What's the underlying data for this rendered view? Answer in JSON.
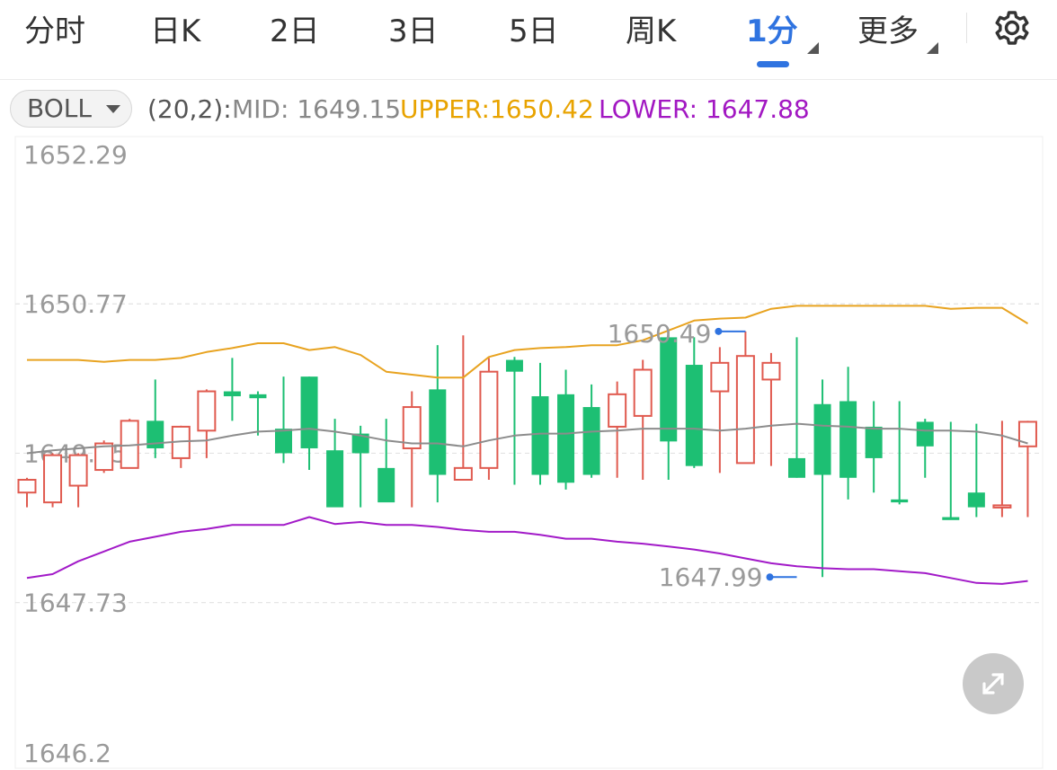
{
  "tabs": {
    "items": [
      {
        "label": "分时"
      },
      {
        "label": "日K"
      },
      {
        "label": "2日"
      },
      {
        "label": "3日"
      },
      {
        "label": "5日"
      },
      {
        "label": "周K"
      },
      {
        "label": "1分"
      },
      {
        "label": "更多"
      }
    ],
    "active_index": 6,
    "active_color": "#2f73e0"
  },
  "indicator": {
    "selector_label": "BOLL",
    "params": "(20,2):",
    "mid_label": "MID: 1649.15",
    "upper_label": "UPPER:1650.42",
    "lower_label": "LOWER: 1647.88",
    "mid_color": "#888888",
    "upper_color": "#e8a300",
    "lower_color": "#a218c2"
  },
  "colors": {
    "up": "#e05a4f",
    "down": "#1dbf73",
    "mid_line": "#8c8c8c",
    "upper_line": "#e8a320",
    "lower_line": "#a21ac8",
    "marker": "#2f73e0"
  },
  "chart_data": {
    "type": "candlestick",
    "interval": "1分",
    "y_ticks": [
      "1652.29",
      "1650.77",
      "1649.25",
      "1647.73",
      "1646.2"
    ],
    "ylim": [
      1646.2,
      1652.29
    ],
    "grid": true,
    "max_marker": {
      "index": 28,
      "label": "1650.49",
      "value": 1650.49
    },
    "min_marker": {
      "index": 30,
      "label": "1647.99",
      "value": 1647.99
    },
    "candles": [
      {
        "o": 1648.85,
        "h": 1649.0,
        "l": 1648.7,
        "c": 1648.98
      },
      {
        "o": 1648.75,
        "h": 1649.25,
        "l": 1648.7,
        "c": 1649.23
      },
      {
        "o": 1648.92,
        "h": 1649.25,
        "l": 1648.7,
        "c": 1649.23
      },
      {
        "o": 1649.08,
        "h": 1649.38,
        "l": 1649.05,
        "c": 1649.35
      },
      {
        "o": 1649.1,
        "h": 1649.6,
        "l": 1649.1,
        "c": 1649.58
      },
      {
        "o": 1649.58,
        "h": 1650.0,
        "l": 1649.2,
        "c": 1649.3
      },
      {
        "o": 1649.2,
        "h": 1649.53,
        "l": 1649.1,
        "c": 1649.52
      },
      {
        "o": 1649.48,
        "h": 1649.9,
        "l": 1649.2,
        "c": 1649.88
      },
      {
        "o": 1649.88,
        "h": 1650.22,
        "l": 1649.58,
        "c": 1649.83
      },
      {
        "o": 1649.85,
        "h": 1649.88,
        "l": 1649.43,
        "c": 1649.81
      },
      {
        "o": 1649.5,
        "h": 1650.03,
        "l": 1649.15,
        "c": 1649.25
      },
      {
        "o": 1650.03,
        "h": 1650.03,
        "l": 1649.08,
        "c": 1649.3
      },
      {
        "o": 1649.28,
        "h": 1649.6,
        "l": 1648.88,
        "c": 1648.7
      },
      {
        "o": 1649.45,
        "h": 1649.53,
        "l": 1648.7,
        "c": 1649.25
      },
      {
        "o": 1649.1,
        "h": 1649.6,
        "l": 1648.85,
        "c": 1648.75
      },
      {
        "o": 1649.3,
        "h": 1649.88,
        "l": 1648.7,
        "c": 1649.72
      },
      {
        "o": 1649.9,
        "h": 1650.35,
        "l": 1648.75,
        "c": 1649.03
      },
      {
        "o": 1648.98,
        "h": 1650.45,
        "l": 1648.98,
        "c": 1649.1
      },
      {
        "o": 1649.1,
        "h": 1650.22,
        "l": 1648.98,
        "c": 1650.08
      },
      {
        "o": 1650.2,
        "h": 1650.23,
        "l": 1648.93,
        "c": 1650.08
      },
      {
        "o": 1649.83,
        "h": 1650.17,
        "l": 1648.93,
        "c": 1649.03
      },
      {
        "o": 1649.85,
        "h": 1650.1,
        "l": 1648.88,
        "c": 1648.95
      },
      {
        "o": 1649.72,
        "h": 1649.95,
        "l": 1649.0,
        "c": 1649.03
      },
      {
        "o": 1649.52,
        "h": 1649.98,
        "l": 1649.0,
        "c": 1649.85
      },
      {
        "o": 1649.63,
        "h": 1650.2,
        "l": 1648.98,
        "c": 1650.1
      },
      {
        "o": 1650.43,
        "h": 1650.45,
        "l": 1648.98,
        "c": 1649.37
      },
      {
        "o": 1650.15,
        "h": 1650.43,
        "l": 1649.1,
        "c": 1649.12
      },
      {
        "o": 1649.88,
        "h": 1650.33,
        "l": 1649.05,
        "c": 1650.17
      },
      {
        "o": 1649.15,
        "h": 1650.49,
        "l": 1649.15,
        "c": 1650.24
      },
      {
        "o": 1650.0,
        "h": 1650.27,
        "l": 1649.12,
        "c": 1650.17
      },
      {
        "o": 1649.2,
        "h": 1650.43,
        "l": 1649.0,
        "c": 1649.0
      },
      {
        "o": 1649.75,
        "h": 1650.0,
        "l": 1647.99,
        "c": 1649.03
      },
      {
        "o": 1649.78,
        "h": 1650.13,
        "l": 1648.78,
        "c": 1649.0
      },
      {
        "o": 1649.52,
        "h": 1649.78,
        "l": 1648.85,
        "c": 1649.2
      },
      {
        "o": 1648.78,
        "h": 1649.78,
        "l": 1648.73,
        "c": 1648.75
      },
      {
        "o": 1649.57,
        "h": 1649.6,
        "l": 1649.0,
        "c": 1649.32
      },
      {
        "o": 1648.6,
        "h": 1649.57,
        "l": 1648.58,
        "c": 1648.57
      },
      {
        "o": 1648.85,
        "h": 1649.55,
        "l": 1648.6,
        "c": 1648.7
      },
      {
        "o": 1648.7,
        "h": 1649.58,
        "l": 1648.6,
        "c": 1648.72
      },
      {
        "o": 1649.32,
        "h": 1649.58,
        "l": 1648.6,
        "c": 1649.57
      }
    ],
    "boll_mid": [
      1649.25,
      1649.28,
      1649.3,
      1649.32,
      1649.33,
      1649.35,
      1649.37,
      1649.38,
      1649.43,
      1649.47,
      1649.48,
      1649.5,
      1649.47,
      1649.43,
      1649.38,
      1649.35,
      1649.35,
      1649.32,
      1649.38,
      1649.43,
      1649.45,
      1649.45,
      1649.47,
      1649.48,
      1649.5,
      1649.5,
      1649.5,
      1649.48,
      1649.5,
      1649.53,
      1649.55,
      1649.53,
      1649.52,
      1649.5,
      1649.5,
      1649.48,
      1649.48,
      1649.47,
      1649.43,
      1649.35
    ],
    "boll_upper": [
      1650.2,
      1650.2,
      1650.2,
      1650.18,
      1650.2,
      1650.2,
      1650.22,
      1650.28,
      1650.32,
      1650.37,
      1650.37,
      1650.3,
      1650.33,
      1650.25,
      1650.08,
      1650.05,
      1650.02,
      1650.02,
      1650.23,
      1650.3,
      1650.32,
      1650.33,
      1650.35,
      1650.35,
      1650.4,
      1650.5,
      1650.6,
      1650.62,
      1650.63,
      1650.72,
      1650.75,
      1650.75,
      1650.75,
      1650.75,
      1650.75,
      1650.75,
      1650.72,
      1650.73,
      1650.73,
      1650.57
    ],
    "boll_lower": [
      1647.98,
      1648.02,
      1648.15,
      1648.25,
      1648.35,
      1648.4,
      1648.45,
      1648.48,
      1648.52,
      1648.52,
      1648.52,
      1648.6,
      1648.53,
      1648.55,
      1648.52,
      1648.52,
      1648.5,
      1648.47,
      1648.45,
      1648.45,
      1648.42,
      1648.38,
      1648.38,
      1648.35,
      1648.33,
      1648.3,
      1648.27,
      1648.23,
      1648.18,
      1648.13,
      1648.1,
      1648.08,
      1648.07,
      1648.07,
      1648.05,
      1648.03,
      1647.98,
      1647.93,
      1647.92,
      1647.95
    ]
  }
}
